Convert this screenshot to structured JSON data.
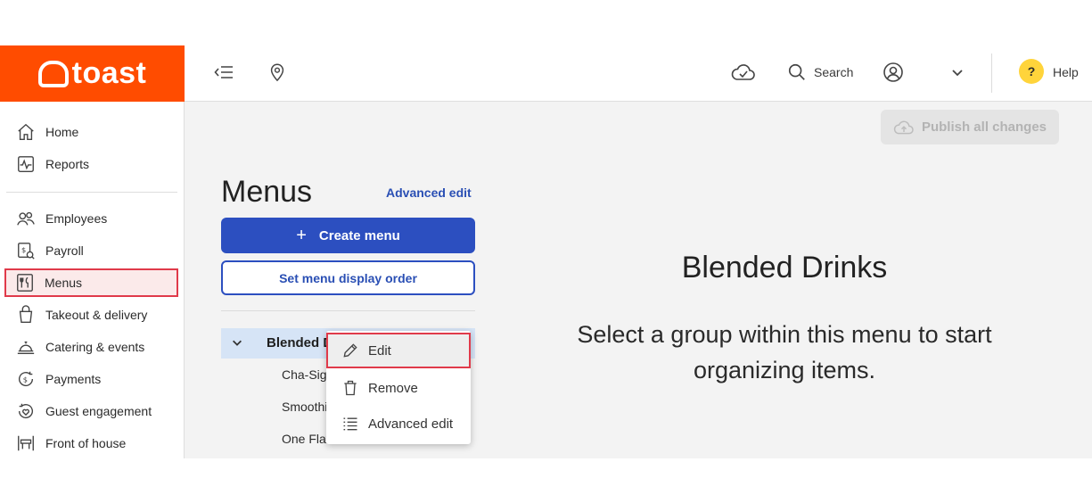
{
  "brand": {
    "name": "toast",
    "color": "#ff4c00"
  },
  "topbar": {
    "search_label": "Search",
    "help_label": "Help",
    "help_badge": "?"
  },
  "sidebar": {
    "items": [
      {
        "label": "Home",
        "icon": "home-icon"
      },
      {
        "label": "Reports",
        "icon": "reports-icon"
      },
      {
        "label": "Employees",
        "icon": "employees-icon"
      },
      {
        "label": "Payroll",
        "icon": "payroll-icon"
      },
      {
        "label": "Menus",
        "icon": "menus-icon",
        "active": true
      },
      {
        "label": "Takeout & delivery",
        "icon": "takeout-icon"
      },
      {
        "label": "Catering & events",
        "icon": "catering-icon"
      },
      {
        "label": "Payments",
        "icon": "payments-icon"
      },
      {
        "label": "Guest engagement",
        "icon": "guest-engagement-icon"
      },
      {
        "label": "Front of house",
        "icon": "front-of-house-icon"
      }
    ]
  },
  "main": {
    "publish_label": "Publish all changes",
    "title": "Menus",
    "advanced_edit_link": "Advanced edit",
    "create_menu_label": "Create menu",
    "create_menu_plus": "+",
    "set_order_label": "Set menu display order",
    "tree": {
      "selected_menu": "Blended Drinks",
      "children": [
        "Cha-Sig",
        "Smoothie",
        "One Flavor"
      ]
    },
    "context_menu": {
      "items": [
        "Edit",
        "Remove",
        "Advanced edit"
      ]
    },
    "panel": {
      "title": "Blended Drinks",
      "message": "Select a group within this menu to start organizing items."
    }
  },
  "colors": {
    "accent": "#2c4fc0",
    "highlight_border": "#e03a4a",
    "selected_row": "#d6e4f6"
  }
}
